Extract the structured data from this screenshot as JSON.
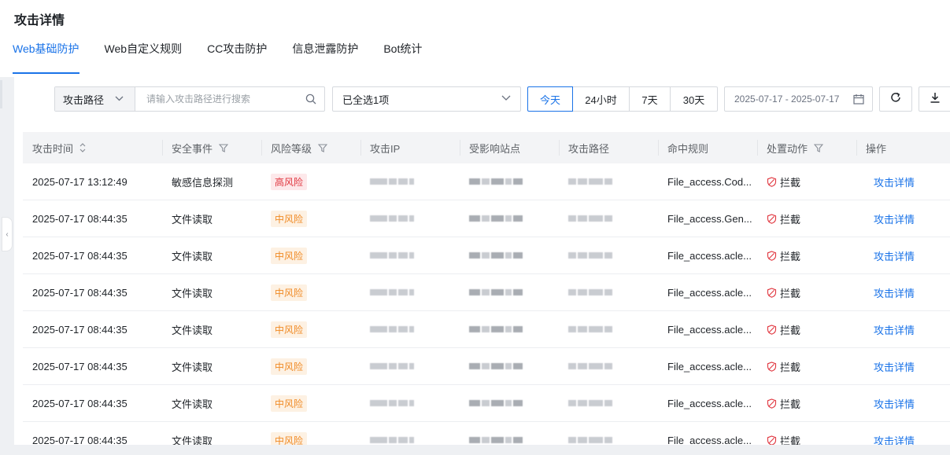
{
  "page": {
    "title": "攻击详情"
  },
  "tabs": [
    {
      "label": "Web基础防护",
      "active": true
    },
    {
      "label": "Web自定义规则",
      "active": false
    },
    {
      "label": "CC攻击防护",
      "active": false
    },
    {
      "label": "信息泄露防护",
      "active": false
    },
    {
      "label": "Bot统计",
      "active": false
    }
  ],
  "filters": {
    "field_select": "攻击路径",
    "search_placeholder": "请输入攻击路径进行搜索",
    "multi_select": "已全选1项",
    "ranges": [
      "今天",
      "24小时",
      "7天",
      "30天"
    ],
    "active_range": "今天",
    "date_range": "2025-07-17 - 2025-07-17"
  },
  "table": {
    "columns": [
      "攻击时间",
      "安全事件",
      "风险等级",
      "攻击IP",
      "受影响站点",
      "攻击路径",
      "命中规则",
      "处置动作",
      "操作"
    ],
    "rows": [
      {
        "time": "2025-07-17 13:12:49",
        "event": "敏感信息探测",
        "risk": "高风险",
        "rule": "File_access.Cod...",
        "action": "拦截",
        "op": "攻击详情"
      },
      {
        "time": "2025-07-17 08:44:35",
        "event": "文件读取",
        "risk": "中风险",
        "rule": "File_access.Gen...",
        "action": "拦截",
        "op": "攻击详情"
      },
      {
        "time": "2025-07-17 08:44:35",
        "event": "文件读取",
        "risk": "中风险",
        "rule": "File_access.acle...",
        "action": "拦截",
        "op": "攻击详情"
      },
      {
        "time": "2025-07-17 08:44:35",
        "event": "文件读取",
        "risk": "中风险",
        "rule": "File_access.acle...",
        "action": "拦截",
        "op": "攻击详情"
      },
      {
        "time": "2025-07-17 08:44:35",
        "event": "文件读取",
        "risk": "中风险",
        "rule": "File_access.acle...",
        "action": "拦截",
        "op": "攻击详情"
      },
      {
        "time": "2025-07-17 08:44:35",
        "event": "文件读取",
        "risk": "中风险",
        "rule": "File_access.acle...",
        "action": "拦截",
        "op": "攻击详情"
      },
      {
        "time": "2025-07-17 08:44:35",
        "event": "文件读取",
        "risk": "中风险",
        "rule": "File_access.acle...",
        "action": "拦截",
        "op": "攻击详情"
      },
      {
        "time": "2025-07-17 08:44:35",
        "event": "文件读取",
        "risk": "中风险",
        "rule": "File_access.acle...",
        "action": "拦截",
        "op": "攻击详情"
      }
    ]
  },
  "colors": {
    "accent": "#1a73e8",
    "high_risk": "#e0343d",
    "mid_risk": "#f08a24",
    "block": "#e0343d"
  }
}
